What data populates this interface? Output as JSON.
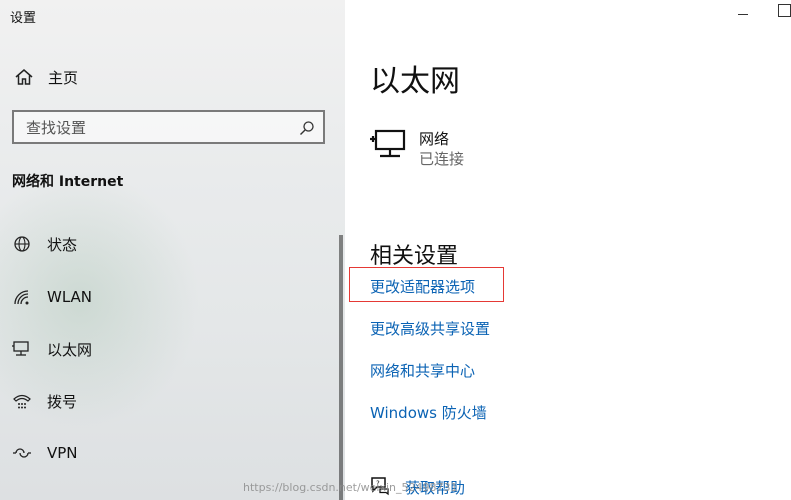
{
  "window": {
    "title": "设置"
  },
  "sidebar": {
    "home_label": "主页",
    "search_placeholder": "查找设置",
    "section_title": "网络和 Internet",
    "items": [
      {
        "label": "状态",
        "icon": "globe-icon"
      },
      {
        "label": "WLAN",
        "icon": "wifi-icon"
      },
      {
        "label": "以太网",
        "icon": "ethernet-icon"
      },
      {
        "label": "拨号",
        "icon": "dialup-icon"
      },
      {
        "label": "VPN",
        "icon": "vpn-icon"
      }
    ]
  },
  "main": {
    "title": "以太网",
    "network": {
      "name": "网络",
      "status": "已连接"
    },
    "related": {
      "title": "相关设置",
      "links": [
        "更改适配器选项",
        "更改高级共享设置",
        "网络和共享中心",
        "Windows 防火墙"
      ]
    },
    "help_label": "获取帮助"
  },
  "watermark": "https://blog.csdn.net/weixin_52498731",
  "colors": {
    "link": "#0b63b4",
    "highlight": "#e53935"
  }
}
